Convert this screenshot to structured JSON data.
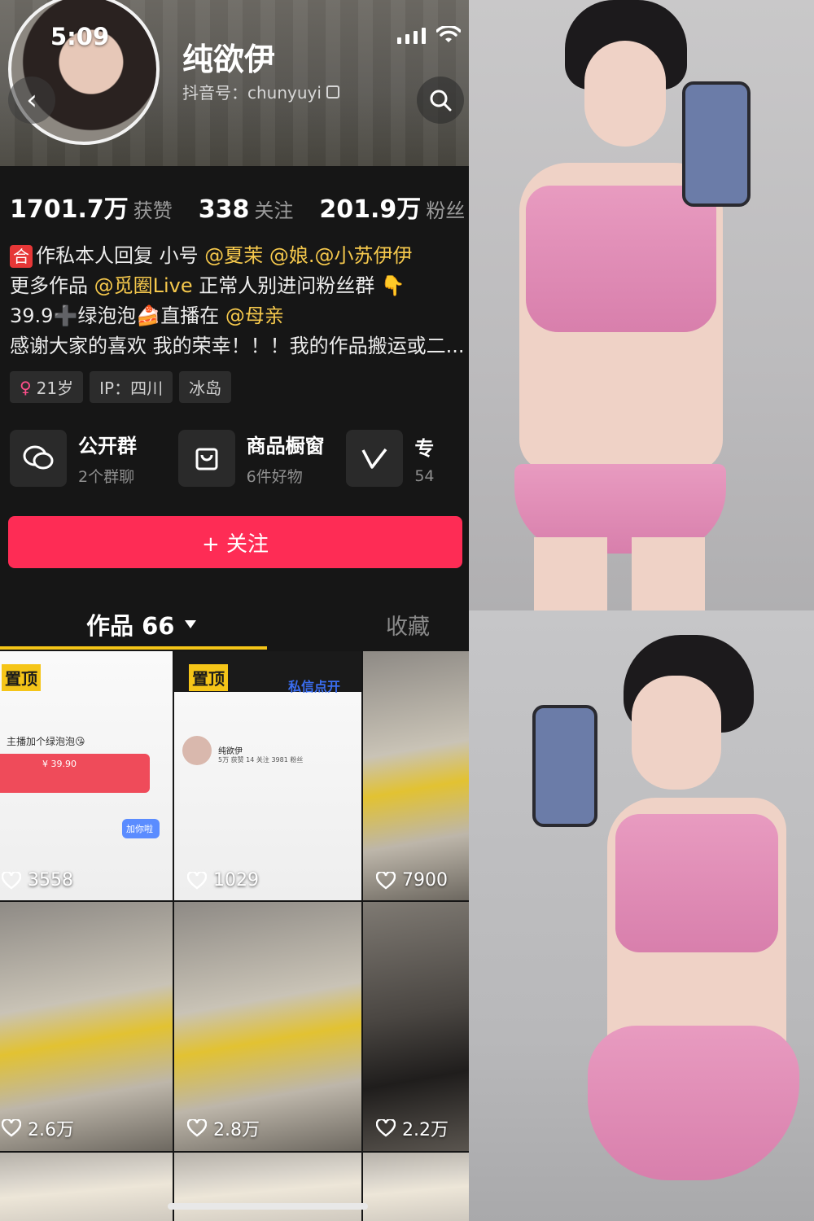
{
  "status_bar": {
    "time": "5:09"
  },
  "profile": {
    "nickname": "纯欲伊",
    "douyin_id": "抖音号：chunyuyi"
  },
  "stats": [
    {
      "value": "1701.7万",
      "label": "获赞"
    },
    {
      "value": "338",
      "label": "关注"
    },
    {
      "value": "201.9万",
      "label": "粉丝"
    }
  ],
  "bio": {
    "line1": {
      "badge": "合",
      "text": "作私本人回复  小号 ",
      "mentions": [
        "@夏茉",
        "@娘.",
        "@小苏伊伊"
      ]
    },
    "line2": {
      "text_before": "更多作品 ",
      "mention": "@觅圈Live",
      "text_after": "  正常人别进问粉丝群 👇"
    },
    "line3": {
      "text_before": "39.9➕绿泡泡🍰直播在 ",
      "mention": "@母亲"
    },
    "line4": "感谢大家的喜欢 我的荣幸！！！我的作品搬运或二..."
  },
  "tags": [
    {
      "icon": "female-icon",
      "text": "21岁"
    },
    {
      "text": "IP：四川"
    },
    {
      "text": "冰岛"
    }
  ],
  "entries": [
    {
      "icon": "chat-bubbles-icon",
      "title": "公开群",
      "sub": "2个群聊"
    },
    {
      "icon": "shopping-bag-icon",
      "title": "商品橱窗",
      "sub": "6件好物"
    },
    {
      "icon": "v-icon",
      "title": "专",
      "sub": "54"
    }
  ],
  "follow_button": "+ 关注",
  "tabs": {
    "works": "作品 66",
    "favorites": "收藏"
  },
  "grid": [
    {
      "pinned": "置顶",
      "likes": "3558"
    },
    {
      "pinned": "置顶",
      "likes": "1029"
    },
    {
      "likes": "7900"
    },
    {
      "likes": "2.6万"
    },
    {
      "likes": "2.8万"
    },
    {
      "likes": "2.2万"
    }
  ],
  "thumbnail_texts": {
    "t1_line": "主播加个绿泡泡😘",
    "t1_price": "¥ 39.90",
    "t1_button": "加你啦",
    "t2_name": "纯欲伊",
    "t2_stats": "5万 获赞  14 关注  3981 粉丝",
    "t2_header": "私信点开"
  },
  "colors": {
    "accent_red": "#fe2c55",
    "mention_yellow": "#f5c84c",
    "tab_underline": "#f5c518",
    "background": "#161616"
  }
}
